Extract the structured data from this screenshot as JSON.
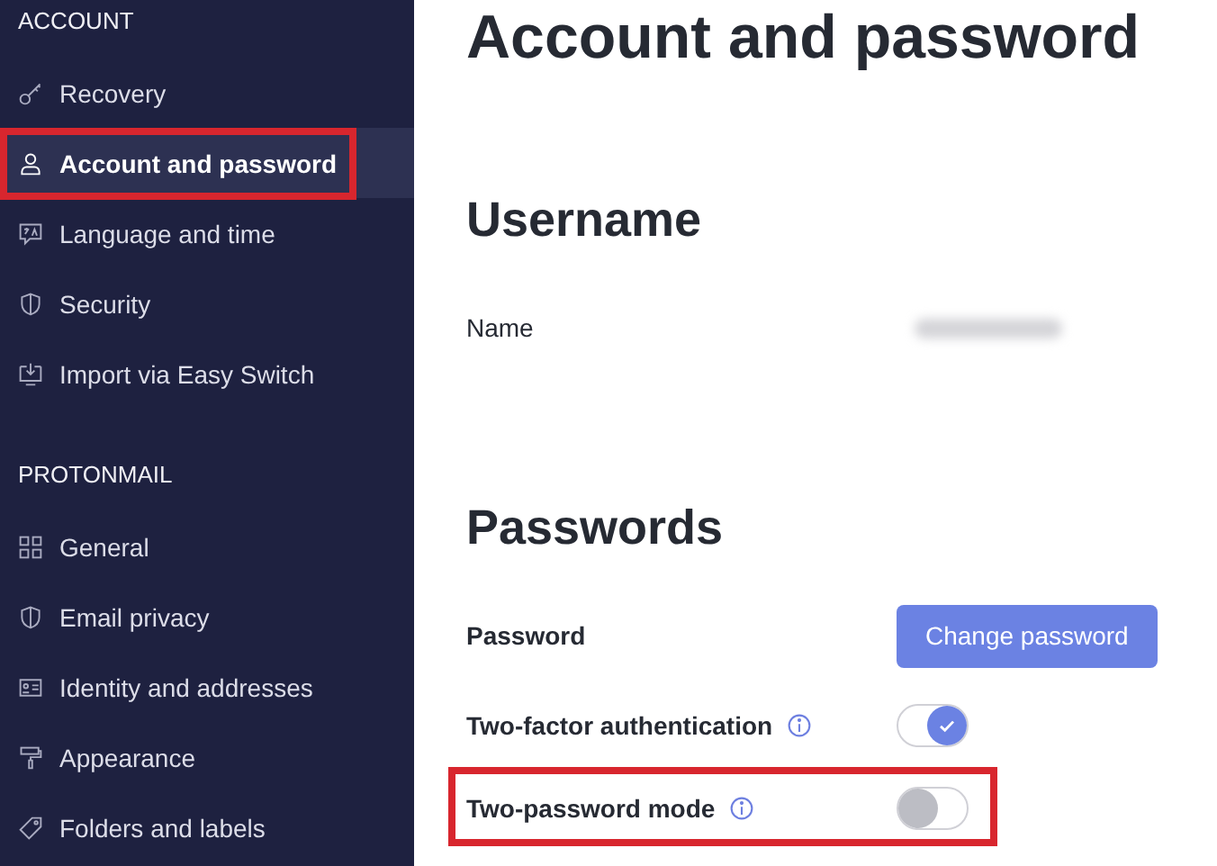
{
  "sidebar": {
    "sections": [
      {
        "heading": "ACCOUNT",
        "items": [
          {
            "label": "Recovery",
            "selected": false,
            "highlighted": false
          },
          {
            "label": "Account and password",
            "selected": true,
            "highlighted": true
          },
          {
            "label": "Language and time",
            "selected": false,
            "highlighted": false
          },
          {
            "label": "Security",
            "selected": false,
            "highlighted": false
          },
          {
            "label": "Import via Easy Switch",
            "selected": false,
            "highlighted": false
          }
        ]
      },
      {
        "heading": "PROTONMAIL",
        "items": [
          {
            "label": "General",
            "selected": false,
            "highlighted": false
          },
          {
            "label": "Email privacy",
            "selected": false,
            "highlighted": false
          },
          {
            "label": "Identity and addresses",
            "selected": false,
            "highlighted": false
          },
          {
            "label": "Appearance",
            "selected": false,
            "highlighted": false
          },
          {
            "label": "Folders and labels",
            "selected": false,
            "highlighted": false
          }
        ]
      }
    ]
  },
  "page": {
    "title": "Account and password",
    "sections": [
      {
        "heading": "Username",
        "rows": [
          {
            "kind": "blurred",
            "label": "Name",
            "info": false,
            "highlighted": false
          }
        ]
      },
      {
        "heading": "Passwords",
        "rows": [
          {
            "kind": "button",
            "label": "Password",
            "info": false,
            "highlighted": false,
            "button": "Change password"
          },
          {
            "kind": "toggle",
            "label": "Two-factor authentication",
            "info": true,
            "highlighted": false,
            "on": true
          },
          {
            "kind": "toggle",
            "label": "Two-password mode",
            "info": true,
            "highlighted": true,
            "on": false
          }
        ]
      }
    ]
  }
}
